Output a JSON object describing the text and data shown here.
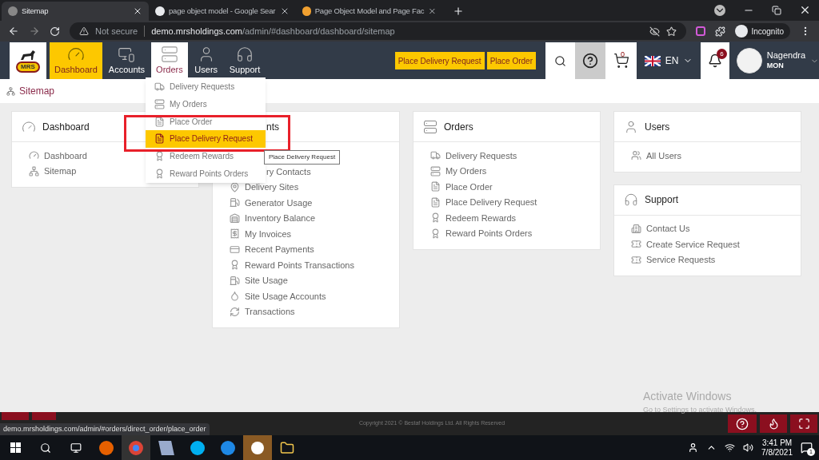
{
  "browser": {
    "tabs": [
      {
        "title": "Sitemap",
        "selected": true
      },
      {
        "title": "page object model - Google Sear",
        "selected": false
      },
      {
        "title": "Page Object Model and Page Fac",
        "selected": false
      }
    ],
    "security": "Not secure",
    "url_host": "demo.mrsholdings.com",
    "url_path": "/admin/#dashboard/dashboard/sitemap",
    "profile": "Incognito"
  },
  "nav": [
    {
      "label": "Dashboard",
      "selected": true,
      "expanded": false
    },
    {
      "label": "Accounts",
      "selected": false,
      "expanded": false
    },
    {
      "label": "Orders",
      "selected": false,
      "expanded": true
    },
    {
      "label": "Users",
      "selected": false,
      "expanded": false
    },
    {
      "label": "Support",
      "selected": false,
      "expanded": false
    }
  ],
  "logo": "MRS",
  "quick_buttons": [
    "Place Delivery Request",
    "Place Order"
  ],
  "cart_count": "0",
  "language": "EN",
  "notification_count": "6",
  "user": {
    "name": "Nagendra",
    "org": "MON"
  },
  "breadcrumb": "Sitemap",
  "dropdown": [
    {
      "label": "Delivery Requests",
      "selected": false
    },
    {
      "label": "My Orders",
      "selected": false
    },
    {
      "label": "Place Order",
      "selected": false
    },
    {
      "label": "Place Delivery Request",
      "selected": true
    },
    {
      "label": "Redeem Rewards",
      "selected": false
    },
    {
      "label": "Reward Points Orders",
      "selected": false
    }
  ],
  "tooltip": "Place Delivery Request",
  "columns": [
    [
      {
        "title": "Dashboard",
        "cut": false,
        "items": [
          {
            "label": "Dashboard",
            "cut": false
          },
          {
            "label": "Sitemap",
            "cut": false
          }
        ]
      }
    ],
    [
      {
        "title": "nts",
        "cut": true,
        "items": [
          {
            "label": "ry Contacts",
            "cut": true
          },
          {
            "label": "Delivery Sites",
            "cut": false
          },
          {
            "label": "Generator Usage",
            "cut": false
          },
          {
            "label": "Inventory Balance",
            "cut": false
          },
          {
            "label": "My Invoices",
            "cut": false
          },
          {
            "label": "Recent Payments",
            "cut": false
          },
          {
            "label": "Reward Points Transactions",
            "cut": false
          },
          {
            "label": "Site Usage",
            "cut": false
          },
          {
            "label": "Site Usage Accounts",
            "cut": false
          },
          {
            "label": "Transactions",
            "cut": false
          }
        ]
      }
    ],
    [
      {
        "title": "Orders",
        "cut": false,
        "items": [
          {
            "label": "Delivery Requests",
            "cut": false
          },
          {
            "label": "My Orders",
            "cut": false
          },
          {
            "label": "Place Order",
            "cut": false
          },
          {
            "label": "Place Delivery Request",
            "cut": false
          },
          {
            "label": "Redeem Rewards",
            "cut": false
          },
          {
            "label": "Reward Points Orders",
            "cut": false
          }
        ]
      }
    ],
    [
      {
        "title": "Users",
        "cut": false,
        "items": [
          {
            "label": "All Users",
            "cut": false
          }
        ]
      },
      {
        "title": "Support",
        "cut": false,
        "items": [
          {
            "label": "Contact Us",
            "cut": false
          },
          {
            "label": "Create Service Request",
            "cut": false
          },
          {
            "label": "Service Requests",
            "cut": false
          }
        ]
      }
    ]
  ],
  "activate": {
    "title": "Activate Windows",
    "subtitle": "Go to Settings to activate Windows."
  },
  "copyright": "Copyright 2021 © Bestaf Holdings Ltd. All Rights Reserved",
  "status_url": "demo.mrsholdings.com/admin/#orders/direct_order/place_order",
  "taskbar": {
    "time": "3:41 PM",
    "date": "7/8/2021",
    "notifications": "1"
  }
}
